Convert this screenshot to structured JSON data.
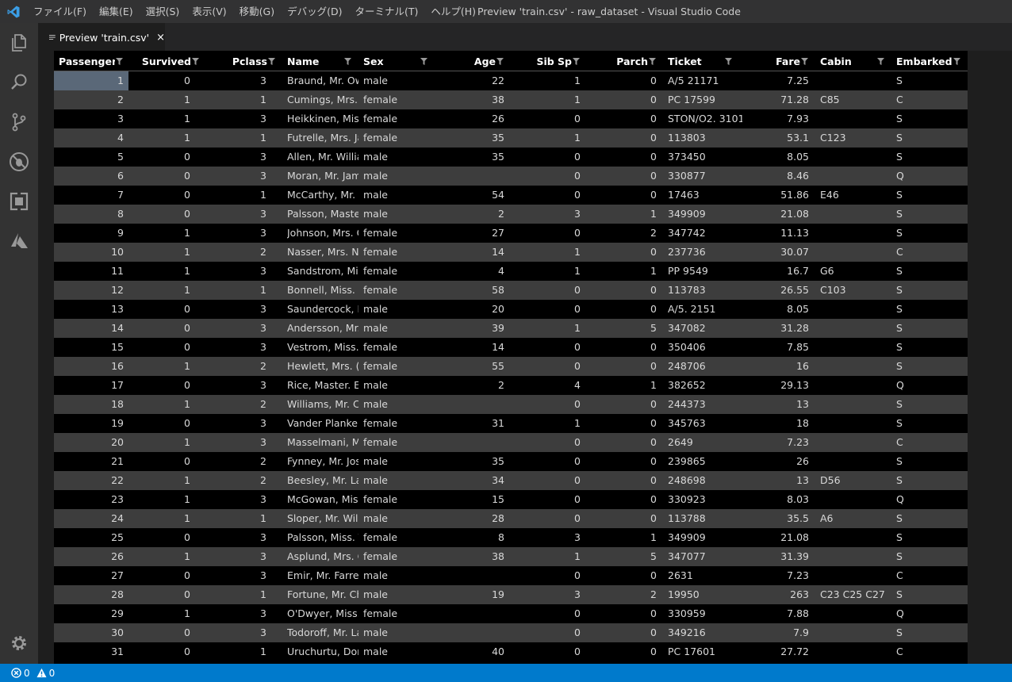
{
  "window": {
    "title": "Preview 'train.csv' - raw_dataset - Visual Studio Code"
  },
  "menu": [
    "ファイル(F)",
    "編集(E)",
    "選択(S)",
    "表示(V)",
    "移動(G)",
    "デバッグ(D)",
    "ターミナル(T)",
    "ヘルプ(H)"
  ],
  "activity_icons": [
    "explorer-icon",
    "search-icon",
    "source-control-icon",
    "debug-icon",
    "extensions-icon",
    "azure-icon",
    "settings-gear-icon"
  ],
  "tab": {
    "label": "Preview 'train.csv'",
    "close": "×"
  },
  "table": {
    "columns": [
      "Passenger Id",
      "Survived",
      "Pclass",
      "Name",
      "Sex",
      "Age",
      "Sib Sp",
      "Parch",
      "Ticket",
      "Fare",
      "Cabin",
      "Embarked"
    ],
    "rows": [
      [
        "1",
        "0",
        "3",
        "Braund, Mr. Ow",
        "male",
        "22",
        "1",
        "0",
        "A/5 21171",
        "7.25",
        "",
        "S"
      ],
      [
        "2",
        "1",
        "1",
        "Cumings, Mrs. J",
        "female",
        "38",
        "1",
        "0",
        "PC 17599",
        "71.28",
        "C85",
        "C"
      ],
      [
        "3",
        "1",
        "3",
        "Heikkinen, Miss.",
        "female",
        "26",
        "0",
        "0",
        "STON/O2. 3101.",
        "7.93",
        "",
        "S"
      ],
      [
        "4",
        "1",
        "1",
        "Futrelle, Mrs. Ja",
        "female",
        "35",
        "1",
        "0",
        "113803",
        "53.1",
        "C123",
        "S"
      ],
      [
        "5",
        "0",
        "3",
        "Allen, Mr. Willia",
        "male",
        "35",
        "0",
        "0",
        "373450",
        "8.05",
        "",
        "S"
      ],
      [
        "6",
        "0",
        "3",
        "Moran, Mr. Jam",
        "male",
        "",
        "0",
        "0",
        "330877",
        "8.46",
        "",
        "Q"
      ],
      [
        "7",
        "0",
        "1",
        "McCarthy, Mr. T",
        "male",
        "54",
        "0",
        "0",
        "17463",
        "51.86",
        "E46",
        "S"
      ],
      [
        "8",
        "0",
        "3",
        "Palsson, Master.",
        "male",
        "2",
        "3",
        "1",
        "349909",
        "21.08",
        "",
        "S"
      ],
      [
        "9",
        "1",
        "3",
        "Johnson, Mrs. O",
        "female",
        "27",
        "0",
        "2",
        "347742",
        "11.13",
        "",
        "S"
      ],
      [
        "10",
        "1",
        "2",
        "Nasser, Mrs. Nic",
        "female",
        "14",
        "1",
        "0",
        "237736",
        "30.07",
        "",
        "C"
      ],
      [
        "11",
        "1",
        "3",
        "Sandstrom, Miss",
        "female",
        "4",
        "1",
        "1",
        "PP 9549",
        "16.7",
        "G6",
        "S"
      ],
      [
        "12",
        "1",
        "1",
        "Bonnell, Miss. El",
        "female",
        "58",
        "0",
        "0",
        "113783",
        "26.55",
        "C103",
        "S"
      ],
      [
        "13",
        "0",
        "3",
        "Saundercock, M",
        "male",
        "20",
        "0",
        "0",
        "A/5. 2151",
        "8.05",
        "",
        "S"
      ],
      [
        "14",
        "0",
        "3",
        "Andersson, Mr.",
        "male",
        "39",
        "1",
        "5",
        "347082",
        "31.28",
        "",
        "S"
      ],
      [
        "15",
        "0",
        "3",
        "Vestrom, Miss. H",
        "female",
        "14",
        "0",
        "0",
        "350406",
        "7.85",
        "",
        "S"
      ],
      [
        "16",
        "1",
        "2",
        "Hewlett, Mrs. (M",
        "female",
        "55",
        "0",
        "0",
        "248706",
        "16",
        "",
        "S"
      ],
      [
        "17",
        "0",
        "3",
        "Rice, Master. Eu",
        "male",
        "2",
        "4",
        "1",
        "382652",
        "29.13",
        "",
        "Q"
      ],
      [
        "18",
        "1",
        "2",
        "Williams, Mr. Ch",
        "male",
        "",
        "0",
        "0",
        "244373",
        "13",
        "",
        "S"
      ],
      [
        "19",
        "0",
        "3",
        "Vander Planke, I",
        "female",
        "31",
        "1",
        "0",
        "345763",
        "18",
        "",
        "S"
      ],
      [
        "20",
        "1",
        "3",
        "Masselmani, Mr",
        "female",
        "",
        "0",
        "0",
        "2649",
        "7.23",
        "",
        "C"
      ],
      [
        "21",
        "0",
        "2",
        "Fynney, Mr. Jos",
        "male",
        "35",
        "0",
        "0",
        "239865",
        "26",
        "",
        "S"
      ],
      [
        "22",
        "1",
        "2",
        "Beesley, Mr. Lav",
        "male",
        "34",
        "0",
        "0",
        "248698",
        "13",
        "D56",
        "S"
      ],
      [
        "23",
        "1",
        "3",
        "McGowan, Miss",
        "female",
        "15",
        "0",
        "0",
        "330923",
        "8.03",
        "",
        "Q"
      ],
      [
        "24",
        "1",
        "1",
        "Sloper, Mr. Willi",
        "male",
        "28",
        "0",
        "0",
        "113788",
        "35.5",
        "A6",
        "S"
      ],
      [
        "25",
        "0",
        "3",
        "Palsson, Miss. To",
        "female",
        "8",
        "3",
        "1",
        "349909",
        "21.08",
        "",
        "S"
      ],
      [
        "26",
        "1",
        "3",
        "Asplund, Mrs. C",
        "female",
        "38",
        "1",
        "5",
        "347077",
        "31.39",
        "",
        "S"
      ],
      [
        "27",
        "0",
        "3",
        "Emir, Mr. Farred",
        "male",
        "",
        "0",
        "0",
        "2631",
        "7.23",
        "",
        "C"
      ],
      [
        "28",
        "0",
        "1",
        "Fortune, Mr. Ch",
        "male",
        "19",
        "3",
        "2",
        "19950",
        "263",
        "C23 C25 C27",
        "S"
      ],
      [
        "29",
        "1",
        "3",
        "O'Dwyer, Miss. I",
        "female",
        "",
        "0",
        "0",
        "330959",
        "7.88",
        "",
        "Q"
      ],
      [
        "30",
        "0",
        "3",
        "Todoroff, Mr. La",
        "male",
        "",
        "0",
        "0",
        "349216",
        "7.9",
        "",
        "S"
      ],
      [
        "31",
        "0",
        "1",
        "Uruchurtu, Don.",
        "male",
        "40",
        "0",
        "0",
        "PC 17601",
        "27.72",
        "",
        "C"
      ]
    ]
  },
  "status": {
    "errors": "0",
    "warnings": "0"
  },
  "colors": {
    "status_bar": "#007acc",
    "alt_row": "#3d3d3d",
    "selected_cell": "#5a6878"
  }
}
